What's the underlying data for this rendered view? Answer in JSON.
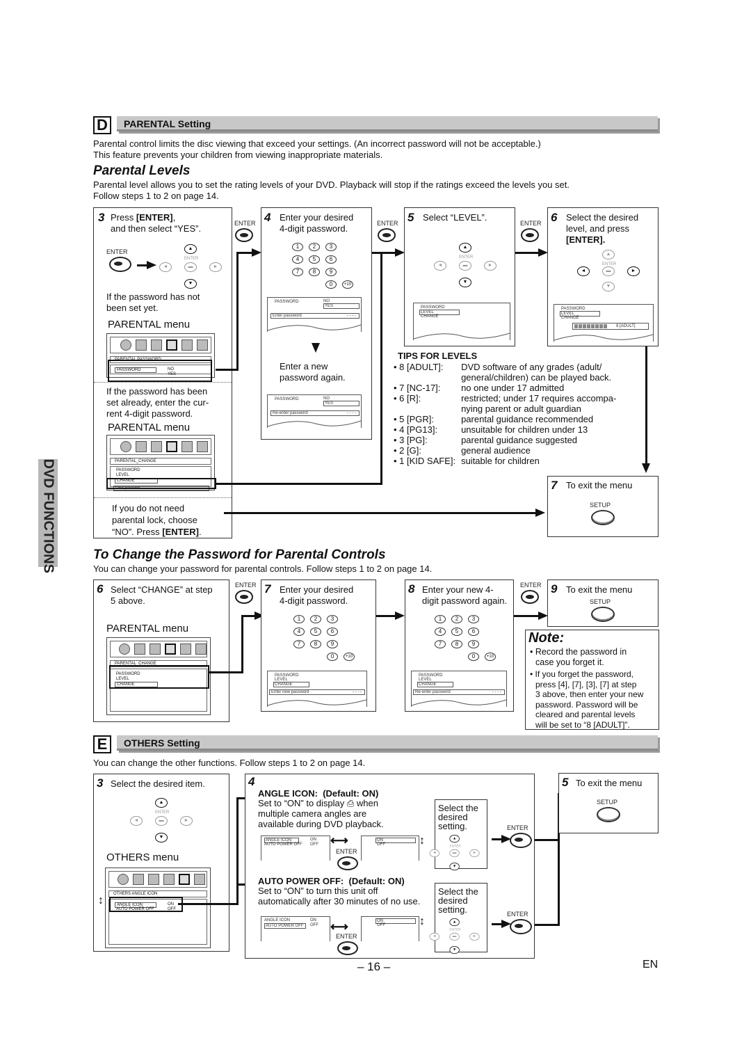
{
  "side_tab": "DVD FUNCTIONS",
  "section_d": {
    "letter": "D",
    "title": "PARENTAL Setting",
    "intro_line1": "Parental control limits the disc viewing that exceed your settings. (An incorrect password will not be acceptable.)",
    "intro_line2": "This feature prevents your children from viewing inappropriate materials.",
    "levels_heading": "Parental Levels",
    "levels_line1": "Parental level allows you to set the rating levels of your DVD. Playback will stop if the ratings exceed the levels you set.",
    "levels_line2": "Follow steps 1 to 2 on page 14."
  },
  "button_labels": {
    "enter": "ENTER",
    "setup": "SETUP"
  },
  "step3": {
    "num": "3",
    "line1_pre": "Press ",
    "line1_bold": "[ENTER]",
    "line1_post": ",",
    "line2": "and then select “YES”.",
    "not_set_1": "If the password has not",
    "not_set_2": "been set yet.",
    "menu_label": "PARENTAL menu",
    "menu1_title": "PARENTAL  PASSWORD",
    "menu1_item": "PASSWORD",
    "menu1_no": "NO",
    "menu1_yes": "YES",
    "set_already_1": "If the password has been",
    "set_already_2": "set already, enter the cur-",
    "set_already_3": "rent 4-digit password.",
    "menu2_title": "PARENTAL_CHANGE",
    "menu2_items": [
      "PASSWORD",
      "LEVEL",
      "CHANGE"
    ],
    "menu2_prompt": "Enter password",
    "menu2_dashes": "- - - -",
    "no_lock_1": "If you do not need",
    "no_lock_2": "parental lock, choose",
    "no_lock_3_pre": "“NO”. Press ",
    "no_lock_3_bold": "[ENTER]",
    "no_lock_3_post": "."
  },
  "step4": {
    "num": "4",
    "line1": "Enter your desired",
    "line2": "4-digit password.",
    "keys": [
      "1",
      "2",
      "3",
      "4",
      "5",
      "6",
      "7",
      "8",
      "9",
      "0",
      "+10"
    ],
    "osd1_label": "PASSWORD",
    "osd1_no": "NO",
    "osd1_yes": "YES",
    "osd1_prompt": "Enter password",
    "osd1_dashes": "- - - -",
    "again_1": "Enter a new",
    "again_2": "password again.",
    "osd2_prompt": "Re-enter password",
    "osd2_dashes": "- - - -"
  },
  "step5": {
    "num": "5",
    "line1": "Select “LEVEL”.",
    "osd_items": [
      "PASSWORD",
      "LEVEL",
      "CHANGE"
    ]
  },
  "step6": {
    "num": "6",
    "line1": "Select the desired",
    "line2": "level, and press",
    "line3": "[ENTER].",
    "osd_items": [
      "PASSWORD",
      "LEVEL",
      "CHANGE"
    ],
    "level_value": "8 [ADULT]",
    "level_fraction": "8/8"
  },
  "tips": {
    "heading": "TIPS FOR LEVELS",
    "rows": [
      {
        "level": "• 8 [ADULT]:",
        "desc": "DVD software of any grades (adult/",
        "desc2": "general/children) can be played back."
      },
      {
        "level": "• 7 [NC-17]:",
        "desc": "no one under 17 admitted"
      },
      {
        "level": "• 6 [R]:",
        "desc": "restricted; under 17 requires accompa-",
        "desc2": "nying parent or adult guardian"
      },
      {
        "level": "• 5 [PGR]:",
        "desc": "parental guidance recommended"
      },
      {
        "level": "• 4 [PG13]:",
        "desc": "unsuitable for children under 13"
      },
      {
        "level": "• 3 [PG]:",
        "desc": "parental guidance suggested"
      },
      {
        "level": "• 2 [G]:",
        "desc": "general audience"
      },
      {
        "level": "• 1 [KID SAFE]:",
        "desc": "suitable for children"
      }
    ]
  },
  "step7_exit": {
    "num": "7",
    "line1": "To exit the menu"
  },
  "change_pw": {
    "heading": "To Change the Password for Parental Controls",
    "intro": "You can change your password for parental controls. Follow steps 1 to 2 on page 14.",
    "s6_num": "6",
    "s6_line1": "Select “CHANGE” at step",
    "s6_line2": "5 above.",
    "s6_menu_label": "PARENTAL menu",
    "s6_menu_title": "PARENTAL_CHANGE",
    "s6_menu_items": [
      "PASSWORD",
      "LEVEL",
      "CHANGE"
    ],
    "s7_num": "7",
    "s7_line1": "Enter your desired",
    "s7_line2": "4-digit password.",
    "s7_prompt": "Enter new password",
    "s8_num": "8",
    "s8_line1": "Enter your new 4-",
    "s8_line2": "digit password again.",
    "s8_prompt": "Re-enter password",
    "dashes": "- - - -",
    "s9_num": "9",
    "s9_line1": "To exit the menu"
  },
  "note": {
    "title": "Note:",
    "b1_l1": "• Record the password in",
    "b1_l2": "case you forget it.",
    "b2_l1": "• If you forget the password,",
    "b2_l2": "press [4], [7], [3], [7] at step",
    "b2_l3": "3 above, then enter your new",
    "b2_l4": "password. Password will be",
    "b2_l5": "cleared and parental levels",
    "b2_l6": "will be set to “8 [ADULT]”."
  },
  "section_e": {
    "letter": "E",
    "title": "OTHERS Setting",
    "intro": "You can change the other functions. Follow steps 1 to 2 on page 14.",
    "s3_num": "3",
    "s3_line1": "Select the desired item.",
    "menu_label": "OTHERS menu",
    "menu_title": "OTHERS  ANGLE ICON",
    "menu_items": [
      {
        "label": "ANGLE ICON",
        "value": "ON"
      },
      {
        "label": "AUTO POWER OFF",
        "value": "OFF"
      }
    ],
    "s4_num": "4",
    "angle_title": "ANGLE ICON:",
    "angle_default": "(Default: ON)",
    "angle_l1_pre": "Set to “ON” to display ",
    "angle_l1_post": " when",
    "angle_l2": "multiple camera angles are",
    "angle_l3": "available during DVD playback.",
    "apo_title": "AUTO POWER OFF:",
    "apo_default": "(Default: ON)",
    "apo_l1": "Set to “ON” to turn this unit off",
    "apo_l2": "automatically after 30 minutes of no use.",
    "select_l1": "Select the",
    "select_l2": "desired",
    "select_l3": "setting.",
    "osd_left": [
      {
        "label": "ANGLE ICON",
        "value": "ON"
      },
      {
        "label": "AUTO POWER OFF",
        "value": "OFF"
      }
    ],
    "osd_right": [
      "ON",
      "OFF"
    ],
    "s5_num": "5",
    "s5_line1": "To exit the menu"
  },
  "footer": {
    "page": "– 16 –",
    "lang": "EN"
  }
}
